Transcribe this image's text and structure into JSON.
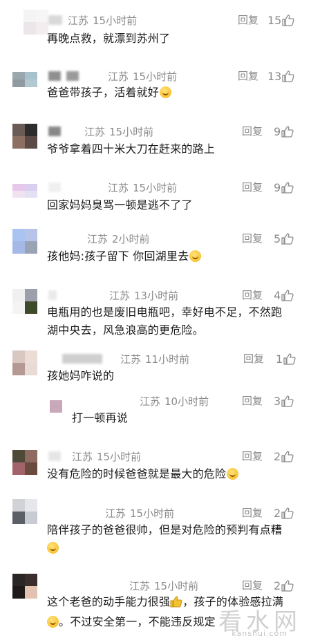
{
  "comments": [
    {
      "location": "江苏",
      "time": "15小时前",
      "reply": "回复",
      "likes": "15",
      "text": "再晚点救，就漂到苏州了",
      "emoji": null
    },
    {
      "location": "江苏",
      "time": "15小时前",
      "reply": "回复",
      "likes": "13",
      "text": "爸爸带孩子，活着就好",
      "emoji": "laugh-emoji"
    },
    {
      "location": "江苏",
      "time": "15小时前",
      "reply": "回复",
      "likes": "9",
      "text": "爷爷拿着四十米大刀在赶来的路上",
      "emoji": null
    },
    {
      "location": "江苏",
      "time": "15小时前",
      "reply": "回复",
      "likes": "9",
      "text": "回家妈妈臭骂一顿是逃不了了",
      "emoji": null
    },
    {
      "location": "江苏",
      "time": "2小时前",
      "reply": "回复",
      "likes": "5",
      "text": "孩他妈:孩子留下 你回湖里去",
      "emoji": "laugh-emoji"
    },
    {
      "location": "江苏",
      "time": "13小时前",
      "reply": "回复",
      "likes": "4",
      "text_line1": "电瓶用的也是废旧电瓶吧，幸好电不足，不然跑",
      "text_line2": "湖中央去，风急浪高的更危险。"
    },
    {
      "location": "江苏",
      "time": "11小时前",
      "reply": "回复",
      "likes": "1",
      "text": "孩她妈咋说的",
      "emoji": null
    },
    {
      "location": "江苏",
      "time": "10小时前",
      "reply": "回复",
      "likes": "3",
      "text": "打一顿再说",
      "emoji": null
    },
    {
      "location": "江苏",
      "time": "15小时前",
      "reply": "回复",
      "likes": "2",
      "text": "没有危险的时候爸爸就是最大的危险",
      "emoji": "laugh-emoji"
    },
    {
      "location": "江苏",
      "time": "15小时前",
      "reply": "回复",
      "likes": "2",
      "text": "陪伴孩子的爸爸很帅，但是对危险的预判有点糟",
      "emoji": "worried-emoji"
    },
    {
      "location": "江苏",
      "time": "15小时前",
      "reply": "回复",
      "likes": "2",
      "text_line1a": "这个老爸的动手能力很强",
      "text_line1b": "，孩子的体验感拉满",
      "text_line2": "。不过安全第一，不能违反规定"
    }
  ],
  "watermark": {
    "main": "看水网",
    "sub": "kanshui.com"
  },
  "colors": {
    "meta": "#8a8a8a",
    "text": "#1a1a1a",
    "background": "#ffffff"
  }
}
